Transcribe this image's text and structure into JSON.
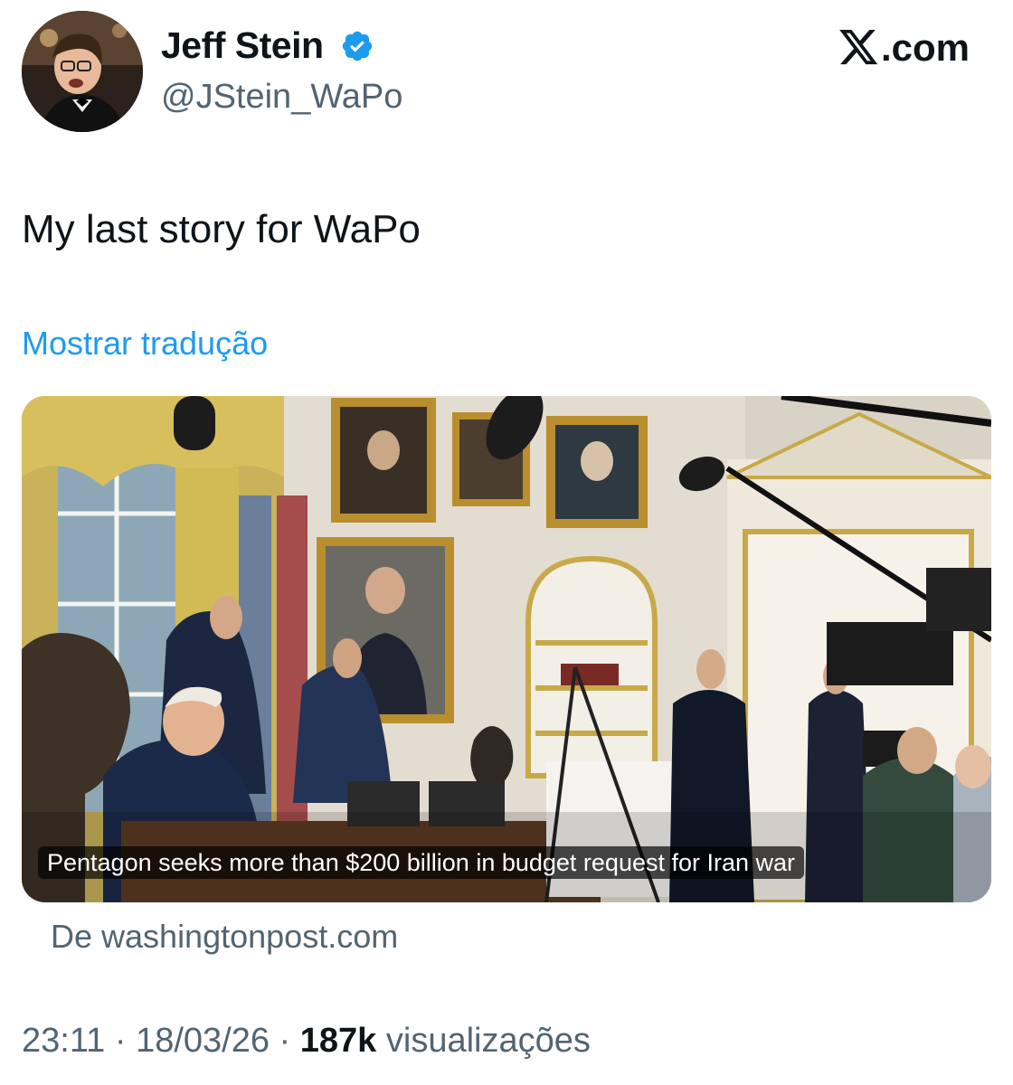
{
  "author": {
    "display_name": "Jeff Stein",
    "handle": "@JStein_WaPo",
    "verified_icon": "verified-badge-icon",
    "avatar_icon": "avatar"
  },
  "brand": {
    "logo_text": ".com",
    "logo_icon": "x-logo-icon"
  },
  "tweet": {
    "text": "My last story for WaPo",
    "translate_label": "Mostrar tradução"
  },
  "card": {
    "headline": "Pentagon seeks more than $200 billion in budget request for Iran war",
    "source": "De washingtonpost.com",
    "image_icon": "article-photo"
  },
  "meta": {
    "time": "23:11",
    "sep1": " · ",
    "date": "18/03/26",
    "sep2": " · ",
    "views_count": "187k",
    "views_label": " visualizações"
  },
  "colors": {
    "text_primary": "#0f1419",
    "text_secondary": "#536471",
    "link_blue": "#1d9bf0",
    "verified_blue": "#1d9bf0"
  }
}
